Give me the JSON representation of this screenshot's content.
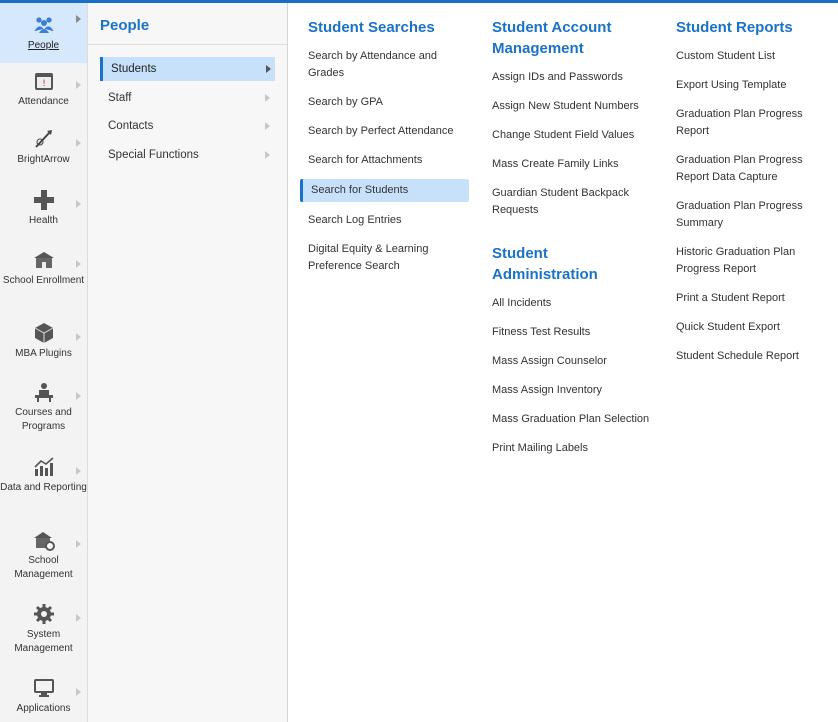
{
  "rail": [
    {
      "label": "People",
      "icon": "people-icon",
      "active": true
    },
    {
      "label": "Attendance",
      "icon": "calendar-icon"
    },
    {
      "label": "BrightArrow",
      "icon": "brightarrow-icon"
    },
    {
      "label": "Health",
      "icon": "health-icon"
    },
    {
      "label": "School Enrollment",
      "icon": "school-icon"
    },
    {
      "label": "MBA Plugins",
      "icon": "plugin-box-icon"
    },
    {
      "label": "Courses and Programs",
      "icon": "teacher-desk-icon"
    },
    {
      "label": "Data and Reporting",
      "icon": "chart-icon"
    },
    {
      "label": "School Management",
      "icon": "school-gear-icon"
    },
    {
      "label": "System Management",
      "icon": "gear-icon"
    },
    {
      "label": "Applications",
      "icon": "monitor-icon"
    }
  ],
  "people": {
    "title": "People",
    "items": [
      {
        "label": "Students"
      },
      {
        "label": "Staff"
      },
      {
        "label": "Contacts"
      },
      {
        "label": "Special Functions"
      }
    ]
  },
  "searches": {
    "title": "Student Searches",
    "links": [
      "Search by Attendance and Grades",
      "Search by GPA",
      "Search by Perfect Attendance",
      "Search for Attachments",
      "Search for Students",
      "Search Log Entries",
      "Digital Equity & Learning Preference Search"
    ]
  },
  "account": {
    "title": "Student Account Management",
    "links": [
      "Assign IDs and Passwords",
      "Assign New Student Numbers",
      "Change Student Field Values",
      "Mass Create Family Links",
      "Guardian Student Backpack Requests"
    ]
  },
  "admin": {
    "title": "Student Administration",
    "links": [
      "All Incidents",
      "Fitness Test Results",
      "Mass Assign Counselor",
      "Mass Assign Inventory",
      "Mass Graduation Plan Selection",
      "Print Mailing Labels"
    ]
  },
  "reports": {
    "title": "Student Reports",
    "links": [
      "Custom Student List",
      "Export Using Template",
      "Graduation Plan Progress Report",
      "Graduation Plan Progress Report Data Capture",
      "Graduation Plan Progress Summary",
      "Historic Graduation Plan Progress Report",
      "Print a Student Report",
      "Quick Student Export",
      "Student Schedule Report"
    ]
  }
}
